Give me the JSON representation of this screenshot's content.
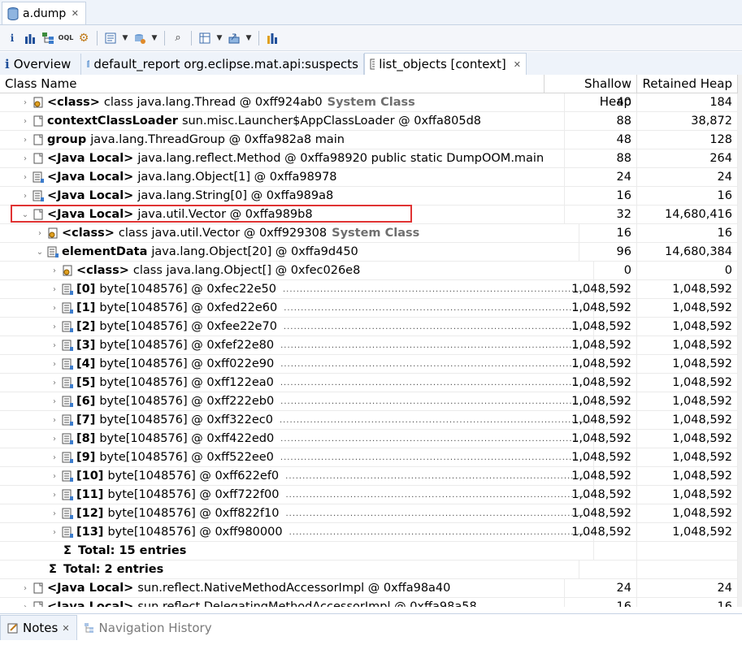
{
  "editor_tab": {
    "title": "a.dump"
  },
  "view_tabs": [
    {
      "label": "Overview"
    },
    {
      "label": "default_report  org.eclipse.mat.api:suspects"
    },
    {
      "label": "list_objects [context]"
    }
  ],
  "table": {
    "headers": {
      "name": "Class Name",
      "shallow": "Shallow Heap",
      "retained": "Retained Heap"
    },
    "rows": [
      {
        "prefix": "<class>",
        "text": "class java.lang.Thread @ 0xff924ab0",
        "tag": "System Class",
        "shallow": "40",
        "retained": "184"
      },
      {
        "prefix": "contextClassLoader",
        "text": "sun.misc.Launcher$AppClassLoader @ 0xffa805d8",
        "shallow": "88",
        "retained": "38,872"
      },
      {
        "prefix": "group",
        "text": "java.lang.ThreadGroup @ 0xffa982a8  main",
        "shallow": "48",
        "retained": "128"
      },
      {
        "prefix": "<Java Local>",
        "text": "java.lang.reflect.Method @ 0xffa98920  public static  DumpOOM.main",
        "shallow": "88",
        "retained": "264"
      },
      {
        "prefix": "<Java Local>",
        "text": "java.lang.Object[1] @ 0xffa98978",
        "shallow": "24",
        "retained": "24"
      },
      {
        "prefix": "<Java Local>",
        "text": "java.lang.String[0] @ 0xffa989a8",
        "shallow": "16",
        "retained": "16"
      },
      {
        "prefix": "<Java Local>",
        "text": "java.util.Vector @ 0xffa989b8",
        "shallow": "32",
        "retained": "14,680,416"
      },
      {
        "prefix": "<class>",
        "text": "class java.util.Vector @ 0xff929308",
        "tag": "System Class",
        "shallow": "16",
        "retained": "16"
      },
      {
        "prefix": "elementData",
        "text": "java.lang.Object[20] @ 0xffa9d450",
        "shallow": "96",
        "retained": "14,680,384"
      },
      {
        "prefix": "<class>",
        "text": "class java.lang.Object[] @ 0xfec026e8",
        "shallow": "0",
        "retained": "0"
      },
      {
        "prefix": "[0]",
        "text": "byte[1048576] @ 0xfec22e50",
        "shallow": "1,048,592",
        "retained": "1,048,592"
      },
      {
        "prefix": "[1]",
        "text": "byte[1048576] @ 0xfed22e60",
        "shallow": "1,048,592",
        "retained": "1,048,592"
      },
      {
        "prefix": "[2]",
        "text": "byte[1048576] @ 0xfee22e70",
        "shallow": "1,048,592",
        "retained": "1,048,592"
      },
      {
        "prefix": "[3]",
        "text": "byte[1048576] @ 0xfef22e80",
        "shallow": "1,048,592",
        "retained": "1,048,592"
      },
      {
        "prefix": "[4]",
        "text": "byte[1048576] @ 0xff022e90",
        "shallow": "1,048,592",
        "retained": "1,048,592"
      },
      {
        "prefix": "[5]",
        "text": "byte[1048576] @ 0xff122ea0",
        "shallow": "1,048,592",
        "retained": "1,048,592"
      },
      {
        "prefix": "[6]",
        "text": "byte[1048576] @ 0xff222eb0",
        "shallow": "1,048,592",
        "retained": "1,048,592"
      },
      {
        "prefix": "[7]",
        "text": "byte[1048576] @ 0xff322ec0",
        "shallow": "1,048,592",
        "retained": "1,048,592"
      },
      {
        "prefix": "[8]",
        "text": "byte[1048576] @ 0xff422ed0",
        "shallow": "1,048,592",
        "retained": "1,048,592"
      },
      {
        "prefix": "[9]",
        "text": "byte[1048576] @ 0xff522ee0",
        "shallow": "1,048,592",
        "retained": "1,048,592"
      },
      {
        "prefix": "[10]",
        "text": "byte[1048576] @ 0xff622ef0",
        "shallow": "1,048,592",
        "retained": "1,048,592"
      },
      {
        "prefix": "[11]",
        "text": "byte[1048576] @ 0xff722f00",
        "shallow": "1,048,592",
        "retained": "1,048,592"
      },
      {
        "prefix": "[12]",
        "text": "byte[1048576] @ 0xff822f10",
        "shallow": "1,048,592",
        "retained": "1,048,592"
      },
      {
        "prefix": "[13]",
        "text": "byte[1048576] @ 0xff980000",
        "shallow": "1,048,592",
        "retained": "1,048,592"
      },
      {
        "prefix": "Total: 15 entries"
      },
      {
        "prefix": "Total: 2 entries"
      },
      {
        "prefix": "<Java Local>",
        "text": "sun.reflect.NativeMethodAccessorImpl @ 0xffa98a40",
        "shallow": "24",
        "retained": "24"
      },
      {
        "prefix": "<Java Local>",
        "text": "sun.reflect.DelegatingMethodAccessorImpl @ 0xffa98a58",
        "shallow": "16",
        "retained": "16"
      }
    ]
  },
  "bottom_tabs": [
    {
      "label": "Notes"
    },
    {
      "label": "Navigation History"
    }
  ],
  "colors": {
    "highlight": "#e03333",
    "tab_bg": "#eef3fa",
    "system_class": "#6f6f6f"
  },
  "icons": [
    "database-icon",
    "info-icon",
    "histogram-icon",
    "dominator-tree-icon",
    "oql-icon",
    "gear-icon",
    "query-icon",
    "search-icon",
    "export-icon",
    "object-icon",
    "array-icon",
    "class-icon",
    "notes-icon",
    "history-icon"
  ]
}
